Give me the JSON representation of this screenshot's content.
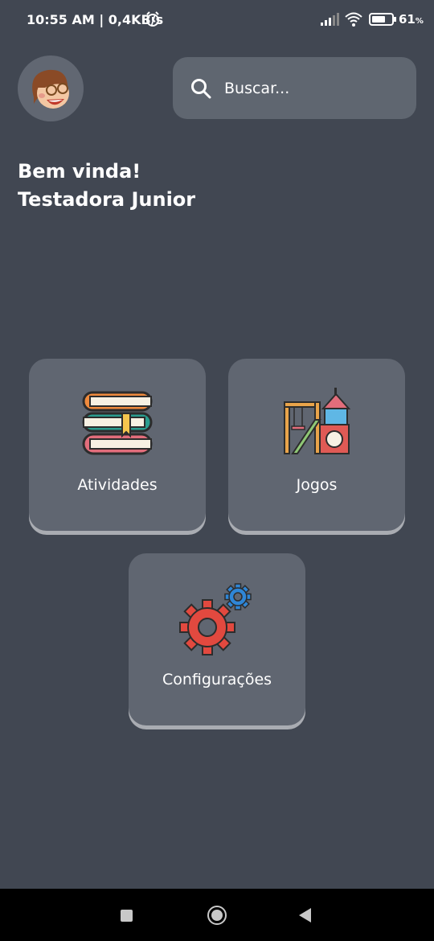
{
  "status_bar": {
    "time_speed": "10:55 AM | 0,4KB/s",
    "battery_percent": "61",
    "battery_unit": "%",
    "icons": [
      "alarm-icon",
      "signal-icon",
      "wifi-icon",
      "battery-icon"
    ]
  },
  "header": {
    "avatar_icon": "girl-avatar-icon",
    "search": {
      "placeholder": "Buscar..."
    }
  },
  "greeting": {
    "line1": "Bem vinda!",
    "line2": "Testadora Junior"
  },
  "menu": {
    "atividades": {
      "label": "Atividades",
      "icon": "books-icon"
    },
    "jogos": {
      "label": "Jogos",
      "icon": "playground-icon"
    },
    "configuracoes": {
      "label": "Configurações",
      "icon": "gears-icon"
    }
  },
  "nav_bar": {
    "icons": [
      "recent-apps-icon",
      "home-icon",
      "back-icon"
    ]
  },
  "colors": {
    "background": "#414752",
    "card": "#606671",
    "card_shadow": "#a9acb2",
    "search_bg": "#5f6670",
    "nav_bar": "#000000"
  }
}
